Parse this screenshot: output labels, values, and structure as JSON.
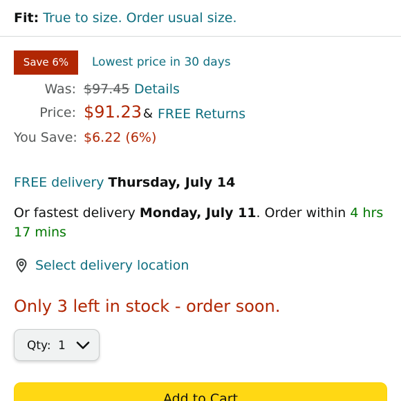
{
  "fit": {
    "label": "Fit:",
    "value": "True to size. Order usual size."
  },
  "deal": {
    "badge": "Save 6%",
    "note": "Lowest price in 30 days"
  },
  "pricing": {
    "was_label": "Was:",
    "was_price": "$97.45",
    "details_link": "Details",
    "price_label": "Price:",
    "price": "$91.23",
    "amp": "&",
    "free_returns": "FREE Returns",
    "you_save_label": "You Save:",
    "you_save_value": "$6.22 (6%)"
  },
  "delivery": {
    "free_delivery": "FREE delivery",
    "free_delivery_date": "Thursday, July 14",
    "fastest_prefix": "Or fastest delivery",
    "fastest_date": "Monday, July 11",
    "order_within": ". Order within",
    "countdown": "4 hrs 17 mins"
  },
  "location": {
    "icon": "location-pin-icon",
    "label": "Select delivery location"
  },
  "stock": {
    "message": "Only 3 left in stock - order soon."
  },
  "quantity": {
    "label": "Qty:",
    "value": "1"
  },
  "cart": {
    "button_label": "Add to Cart"
  },
  "colors": {
    "link": "#0f6f80",
    "price_red": "#b12704",
    "green": "#007600",
    "cart_yellow": "#ffd814"
  }
}
